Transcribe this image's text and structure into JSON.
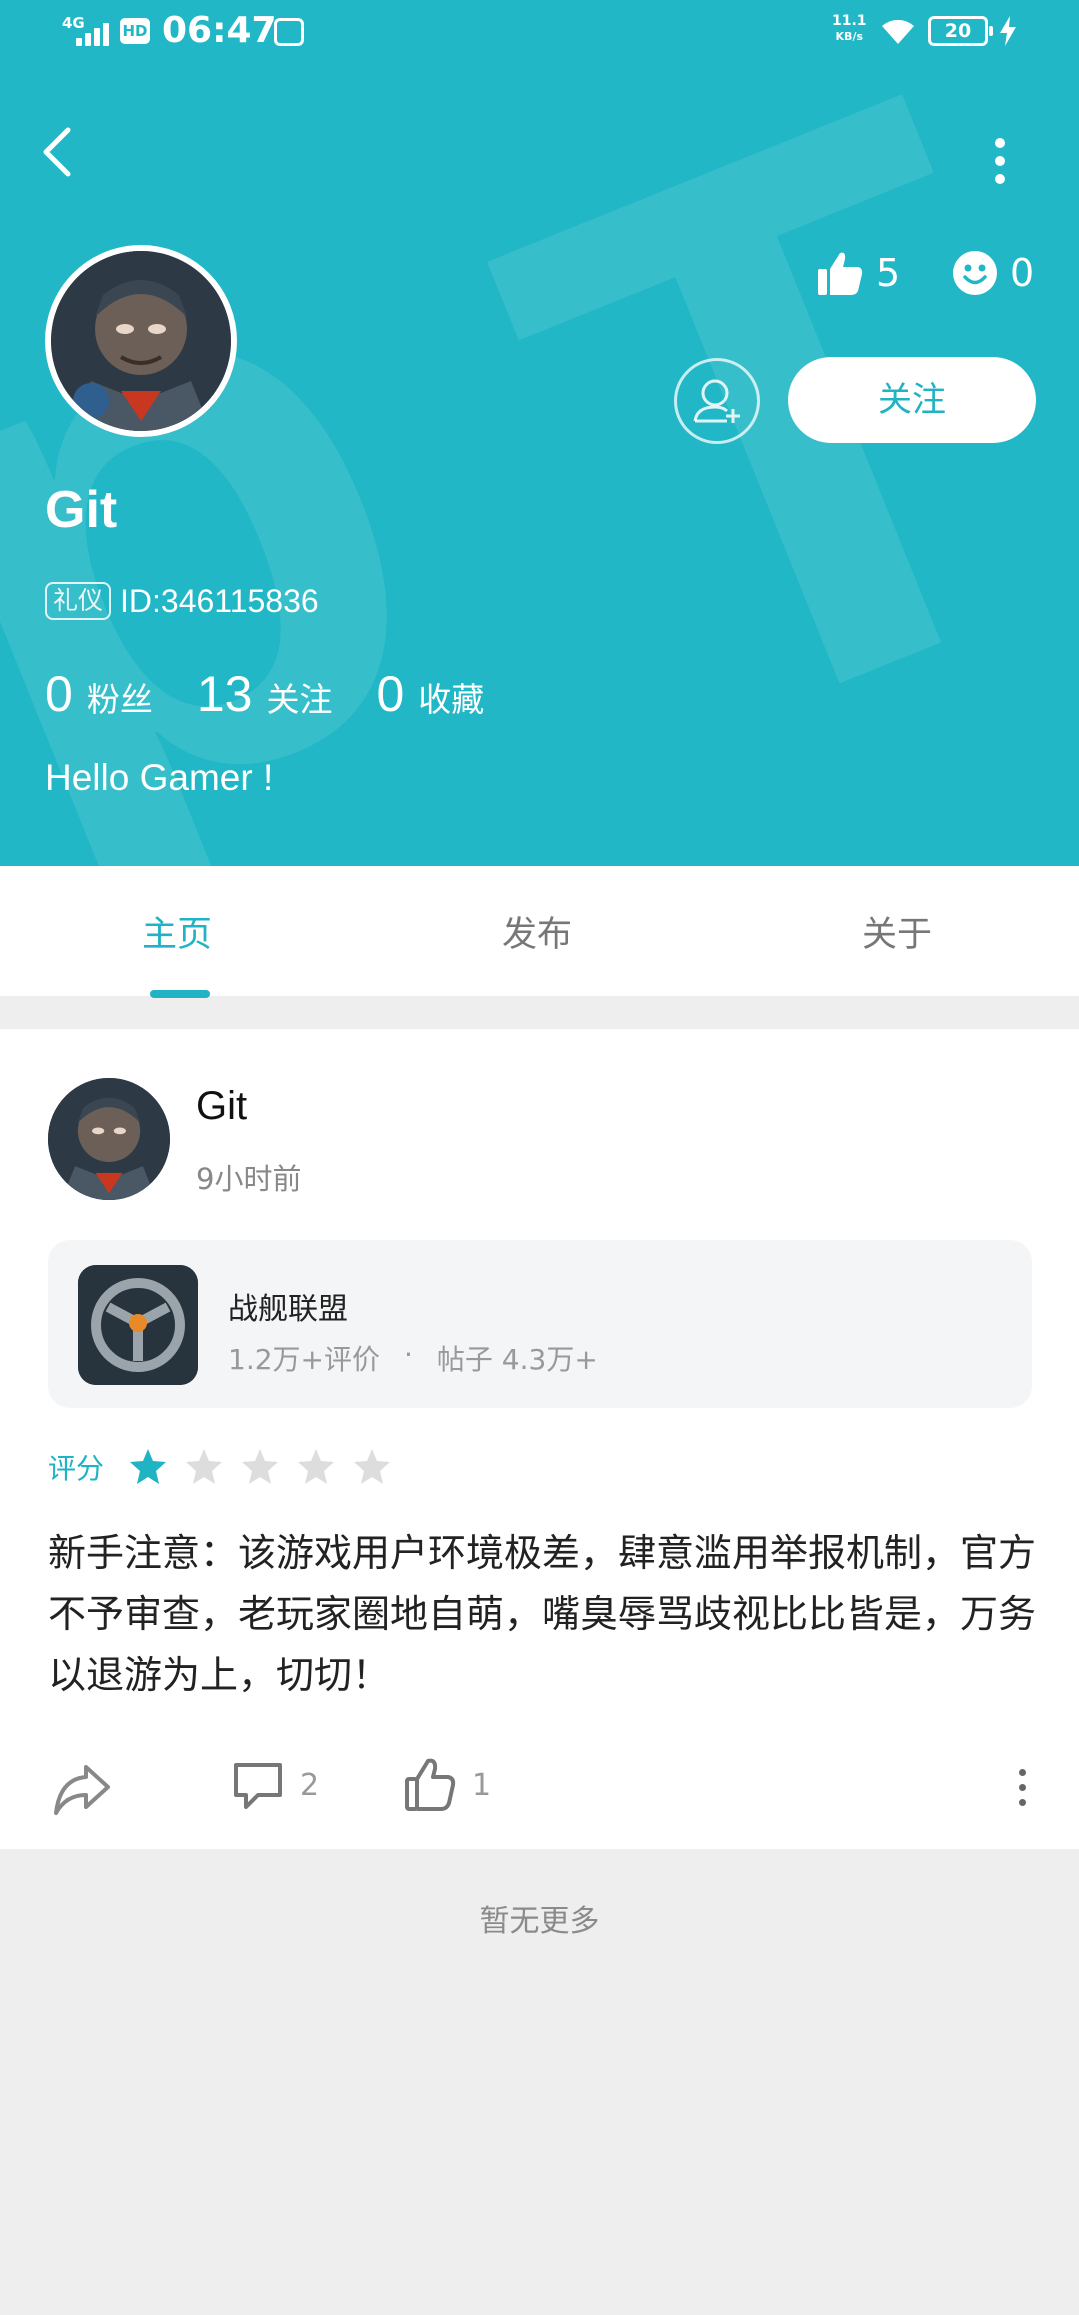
{
  "status_bar": {
    "network": "4G",
    "hd": "HD",
    "time": "06:47",
    "speed_value": "11.1",
    "speed_unit": "KB/s",
    "battery": "20"
  },
  "profile": {
    "likes": "5",
    "emoji_count": "0",
    "follow_label": "关注",
    "name": "Git",
    "badge": "礼仪",
    "id_text": "ID:346115836",
    "fans_count": "0",
    "fans_label": "粉丝",
    "following_count": "13",
    "following_label": "关注",
    "favorites_count": "0",
    "favorites_label": "收藏",
    "bio": "Hello Gamer !"
  },
  "tabs": [
    {
      "label": "主页",
      "active": true
    },
    {
      "label": "发布",
      "active": false
    },
    {
      "label": "关于",
      "active": false
    }
  ],
  "post": {
    "author": "Git",
    "time": "9小时前",
    "game": {
      "name": "战舰联盟",
      "reviews": "1.2万+评价",
      "separator": "·",
      "posts": "帖子 4.3万+"
    },
    "rating_label": "评分",
    "rating": 1,
    "rating_max": 5,
    "body": "新手注意：该游戏用户环境极差，肆意滥用举报机制，官方不予审查，老玩家圈地自萌，嘴臭辱骂歧视比比皆是，万务以退游为上，切切！",
    "comments": "2",
    "likes": "1"
  },
  "footer": {
    "no_more": "暂无更多"
  },
  "colors": {
    "accent": "#21b7c6",
    "star_active": "#1fb3c3",
    "star_inactive": "#dddddd"
  },
  "icons": [
    "back-arrow-icon",
    "more-vertical-icon",
    "thumbs-up-icon",
    "smiley-icon",
    "add-user-icon",
    "star-icon",
    "share-icon",
    "comment-icon",
    "like-icon"
  ]
}
